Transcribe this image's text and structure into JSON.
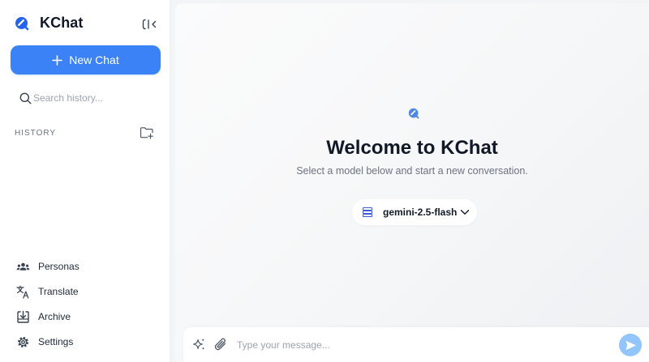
{
  "brand": {
    "name": "KChat",
    "logo_icon": "kchat-logo-icon"
  },
  "sidebar": {
    "collapse_icon": "sidebar-collapse-icon",
    "new_chat_label": "New Chat",
    "search_placeholder": "Search history...",
    "history_label": "HISTORY",
    "nav": [
      {
        "label": "Personas",
        "icon": "people-icon"
      },
      {
        "label": "Translate",
        "icon": "translate-icon"
      },
      {
        "label": "Archive",
        "icon": "archive-icon"
      },
      {
        "label": "Settings",
        "icon": "gear-icon"
      }
    ]
  },
  "main": {
    "welcome_title": "Welcome to KChat",
    "subtitle": "Select a model below and start a new conversation.",
    "model": "gemini-2.5-flash"
  },
  "composer": {
    "placeholder": "Type your message..."
  },
  "colors": {
    "accent": "#3b82f6",
    "send_disabled": "#93c5fd",
    "text_primary": "#111827",
    "text_muted": "#6b7280"
  }
}
